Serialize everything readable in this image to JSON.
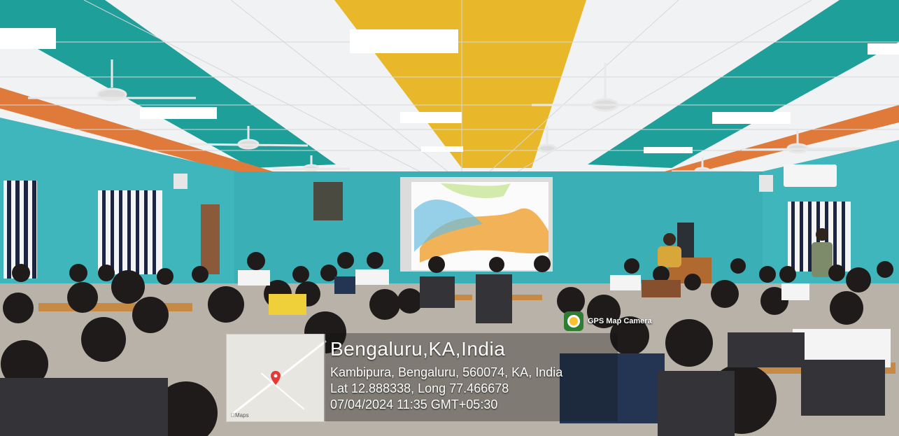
{
  "gps_badge": {
    "label": "GPS Map Camera",
    "icon": "gps-map-camera-icon"
  },
  "location": {
    "city": "Bengaluru,KA,India",
    "address": "Kambipura, Bengaluru, 560074, KA, India",
    "coords": "Lat 12.888338, Long 77.466678",
    "datetime": "07/04/2024 11:35 GMT+05:30"
  },
  "map_thumbnail": {
    "brand": "Maps",
    "pin_color": "#e53935"
  },
  "colors": {
    "wall": "#3fb6bb",
    "ceiling_accent_teal": "#1f9f9a",
    "ceiling_accent_yellow": "#e8b72a",
    "ceiling_accent_orange": "#e07a3a"
  }
}
